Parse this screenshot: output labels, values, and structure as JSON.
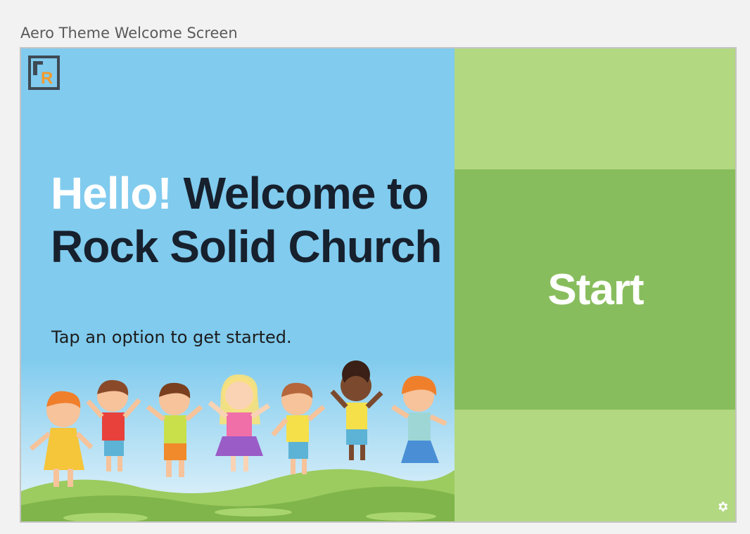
{
  "caption": "Aero Theme Welcome Screen",
  "logo": {
    "icon": "rock-rms-logo",
    "letter": "R"
  },
  "welcome": {
    "hello": "Hello!",
    "message": "Welcome to Rock Solid Church",
    "subtitle": "Tap an option to get started."
  },
  "actions": {
    "start_label": "Start"
  },
  "footer": {
    "settings_icon": "gear-icon"
  },
  "colors": {
    "left_background": "#80cbee",
    "right_background": "#b2d882",
    "start_button": "#88bd5d",
    "heading_dark": "#17202d",
    "logo_accent": "#f39a2b"
  }
}
